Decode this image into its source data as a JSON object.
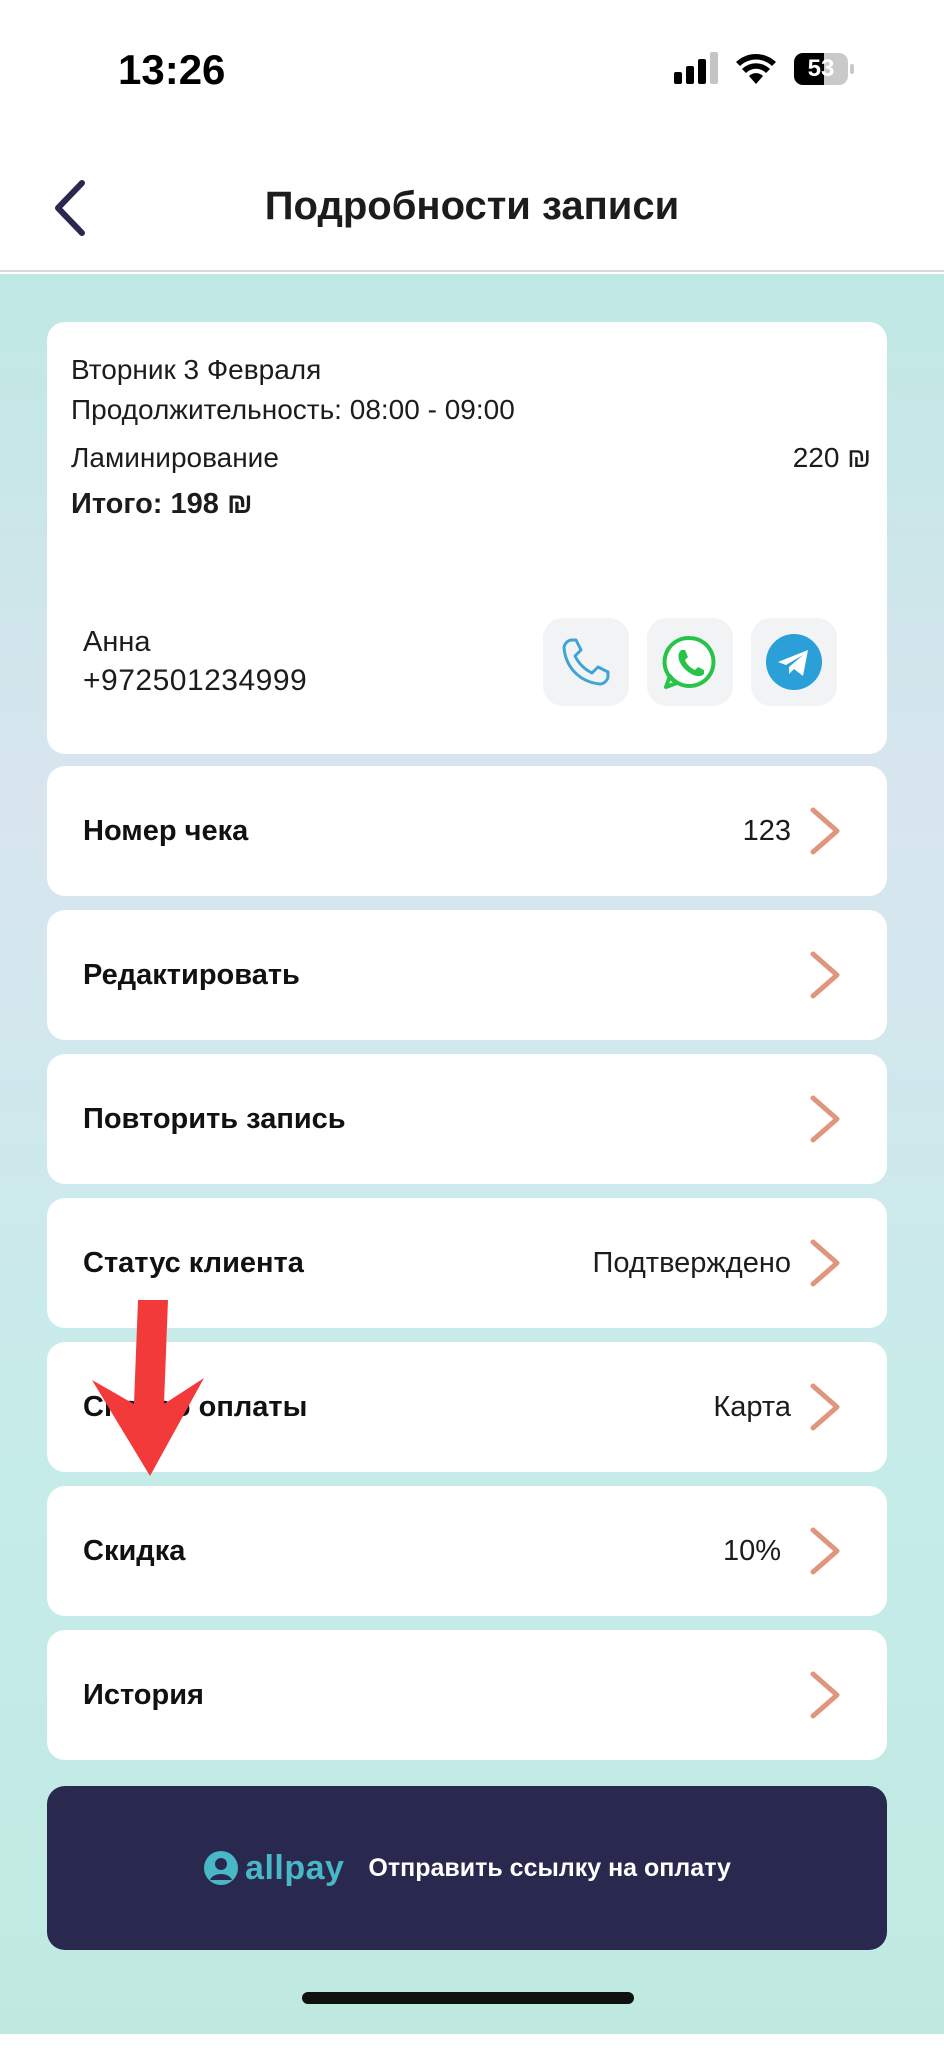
{
  "status_bar": {
    "time": "13:26",
    "battery": "53",
    "icons": [
      "signal-icon",
      "wifi-icon",
      "battery-icon"
    ]
  },
  "header": {
    "title": "Подробности записи",
    "back_icon": "chevron-left-icon"
  },
  "appointment": {
    "date": "Вторник 3 Февраля",
    "duration": "Продолжительность: 08:00 - 09:00",
    "service": "Ламинирование",
    "service_price": "220 ₪",
    "total": "Итого: 198 ₪"
  },
  "client": {
    "name": "Анна",
    "phone": "+972501234999",
    "contact_icons": [
      "phone-icon",
      "whatsapp-icon",
      "telegram-icon"
    ]
  },
  "rows": [
    {
      "label": "Номер чека",
      "value": "123"
    },
    {
      "label": "Редактировать",
      "value": ""
    },
    {
      "label": "Повторить запись",
      "value": ""
    },
    {
      "label": "Статус клиента",
      "value": "Подтверждено"
    },
    {
      "label": "Способ оплаты",
      "value": "Карта"
    },
    {
      "label": "Скидка",
      "value": "10%"
    },
    {
      "label": "История",
      "value": ""
    }
  ],
  "payment": {
    "brand": "allpay",
    "label": "Отправить ссылку на оплату"
  },
  "colors": {
    "accent_chevron": "#e0967e",
    "pay_button": "#29284f",
    "allpay_brand": "#48b7c6",
    "annotation_arrow": "#f23a3a"
  }
}
